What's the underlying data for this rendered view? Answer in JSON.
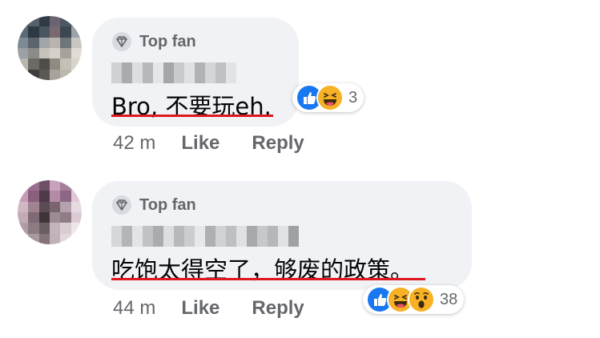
{
  "comments": [
    {
      "badge": "Top fan",
      "text": "Bro, 不要玩eh.",
      "time": "42 m",
      "like_label": "Like",
      "reply_label": "Reply",
      "reactions": [
        "like-icon",
        "haha-icon"
      ],
      "reaction_count": "3"
    },
    {
      "badge": "Top fan",
      "text": "吃饱太得空了，够废的政策。",
      "time": "44 m",
      "like_label": "Like",
      "reply_label": "Reply",
      "reactions": [
        "like-icon",
        "haha-icon",
        "wow-icon"
      ],
      "reaction_count": "38"
    }
  ],
  "colors": {
    "bubble": "#f0f2f5",
    "underline": "#e0171e",
    "like_blue": "#1877f2",
    "haha_yellow": "#f7b125",
    "meta_gray": "#65676b"
  }
}
